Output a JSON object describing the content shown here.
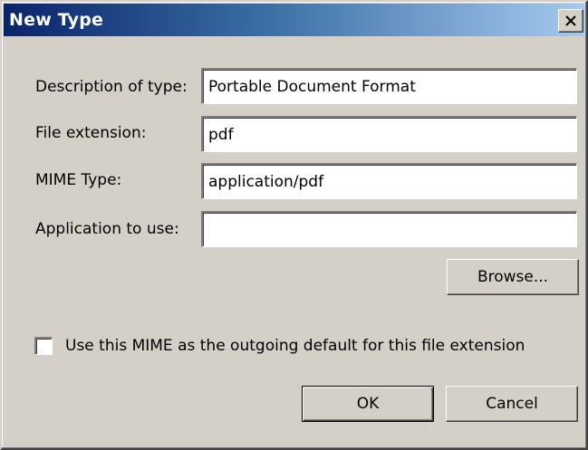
{
  "window": {
    "title": "New Type",
    "close_symbol": "×"
  },
  "form": {
    "description_label": "Description of type:",
    "description_value": "Portable Document Format",
    "extension_label": "File extension:",
    "extension_value": "pdf",
    "mime_label": "MIME Type:",
    "mime_value": "application/pdf",
    "application_label": "Application to use:",
    "application_value": ""
  },
  "browse_label": "Browse...",
  "checkbox": {
    "label": "Use this MIME as the outgoing default for this file extension",
    "checked": false
  },
  "buttons": {
    "ok_label": "OK",
    "cancel_label": "Cancel"
  },
  "colors": {
    "face": "#d4d0c8",
    "title_start": "#0a246a",
    "title_end": "#a6caf0"
  },
  "icons": {
    "close": "close-icon"
  }
}
